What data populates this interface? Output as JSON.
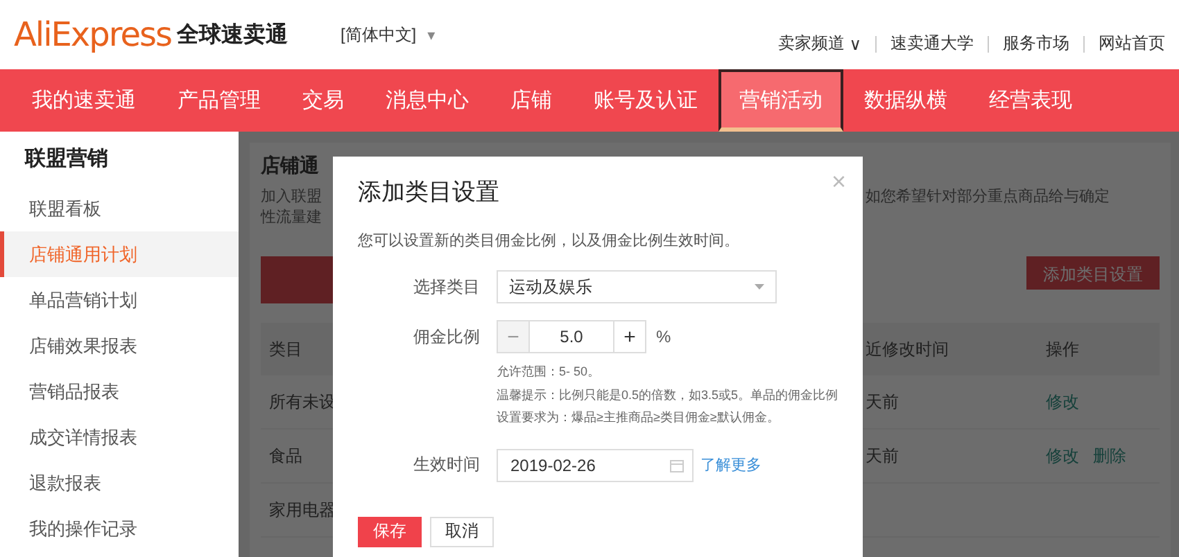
{
  "header": {
    "logo": "AliExpress",
    "logo_subtitle": "全球速卖通",
    "language": "[简体中文]",
    "language_caret": "▾",
    "links": [
      {
        "label": "卖家频道",
        "caret": "∨"
      },
      {
        "label": "速卖通大学"
      },
      {
        "label": "服务市场"
      },
      {
        "label": "网站首页"
      }
    ]
  },
  "nav": [
    {
      "label": "我的速卖通",
      "selected": false
    },
    {
      "label": "产品管理",
      "selected": false
    },
    {
      "label": "交易",
      "selected": false
    },
    {
      "label": "消息中心",
      "selected": false
    },
    {
      "label": "店铺",
      "selected": false
    },
    {
      "label": "账号及认证",
      "selected": false
    },
    {
      "label": "营销活动",
      "selected": true
    },
    {
      "label": "数据纵横",
      "selected": false
    },
    {
      "label": "经营表现",
      "selected": false
    }
  ],
  "sidebar": {
    "title": "联盟营销",
    "items": [
      {
        "label": "联盟看板",
        "selected": false
      },
      {
        "label": "店铺通用计划",
        "selected": true
      },
      {
        "label": "单品营销计划",
        "selected": false
      },
      {
        "label": "店铺效果报表",
        "selected": false
      },
      {
        "label": "营销品报表",
        "selected": false
      },
      {
        "label": "成交详情报表",
        "selected": false
      },
      {
        "label": "退款报表",
        "selected": false
      },
      {
        "label": "我的操作记录",
        "selected": false
      }
    ]
  },
  "background": {
    "title": "店铺通",
    "intro_left": [
      "加入联盟",
      "性流量建"
    ],
    "intro_right": [
      "如您希望针对部分重点商品给与确定"
    ],
    "right_button": "添加类目设置",
    "columns": [
      "类目",
      "近修改时间",
      "操作"
    ],
    "rows": [
      {
        "category": "所有未设",
        "time": "天前",
        "actions": [
          "修改"
        ]
      },
      {
        "category": "食品",
        "time": "天前",
        "actions": [
          "修改",
          "删除"
        ]
      },
      {
        "category": "家用电器",
        "time": "",
        "actions": []
      }
    ]
  },
  "dialog": {
    "title": "添加类目设置",
    "close": "×",
    "subtitle": "您可以设置新的类目佣金比例，以及佣金比例生效时间。",
    "category_label": "选择类目",
    "category_value": "运动及娱乐",
    "rate_label": "佣金比例",
    "minus": "−",
    "rate_value": "5.0",
    "plus": "+",
    "unit": "%",
    "hints": [
      "允许范围：5- 50。",
      "温馨提示：比例只能是0.5的倍数，如3.5或5。单品的佣金比例",
      "设置要求为：爆品≥主推商品≥类目佣金≥默认佣金。"
    ],
    "date_label": "生效时间",
    "date_value": "2019-02-26",
    "learn_more": "了解更多",
    "buttons": [
      {
        "label": "保存",
        "kind": "primary"
      },
      {
        "label": "取消",
        "kind": "secondary"
      }
    ]
  }
}
